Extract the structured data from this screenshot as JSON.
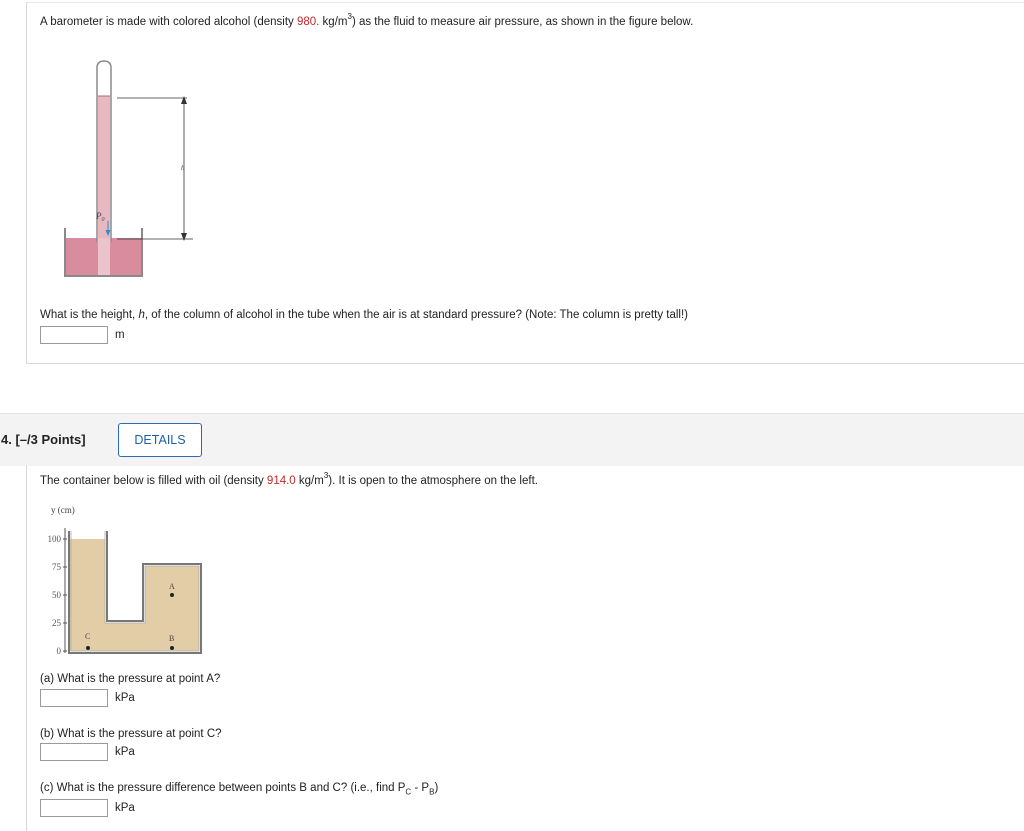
{
  "q3": {
    "intro_pre": "A barometer is made with colored alcohol (density ",
    "density": "980.",
    "intro_unit": " kg/m",
    "intro_exp": "3",
    "intro_post": ") as the fluid to measure air pressure, as shown in the figure below.",
    "figure": {
      "label_p0": "P",
      "label_p0_sub": "0",
      "label_h": "h"
    },
    "question_pre": "What is the height, ",
    "question_var": "h",
    "question_post": ", of the column of alcohol in the tube when the air is at standard pressure? (Note: The column is pretty tall!)",
    "answer_value": "",
    "unit": "m"
  },
  "q4": {
    "title": "4.  [–/3 Points]",
    "details_label": "DETAILS",
    "intro_pre": "The container below is filled with oil (density ",
    "density": "914.0",
    "intro_unit": " kg/m",
    "intro_exp": "3",
    "intro_post": "). It is open to the atmosphere on the left.",
    "figure": {
      "ylabel": "y (cm)",
      "ticks": [
        "100",
        "75",
        "50",
        "25",
        "0"
      ],
      "point_a": "A",
      "point_b": "B",
      "point_c": "C"
    },
    "part_a": {
      "question": "(a) What is the pressure at point A?",
      "value": "",
      "unit": "kPa"
    },
    "part_b": {
      "question": "(b) What is the pressure at point C?",
      "value": "",
      "unit": "kPa"
    },
    "part_c": {
      "question_pre": "(c) What is the pressure difference between points B and C? (i.e., find P",
      "sub1": "C",
      "mid": " - P",
      "sub2": "B",
      "question_post": ")",
      "value": "",
      "unit": "kPa"
    }
  },
  "colors": {
    "accent_red": "#c0282c",
    "link_blue": "#1f5fa6",
    "alcohol": "#e7b8c2",
    "oil": "#e3cda6"
  }
}
